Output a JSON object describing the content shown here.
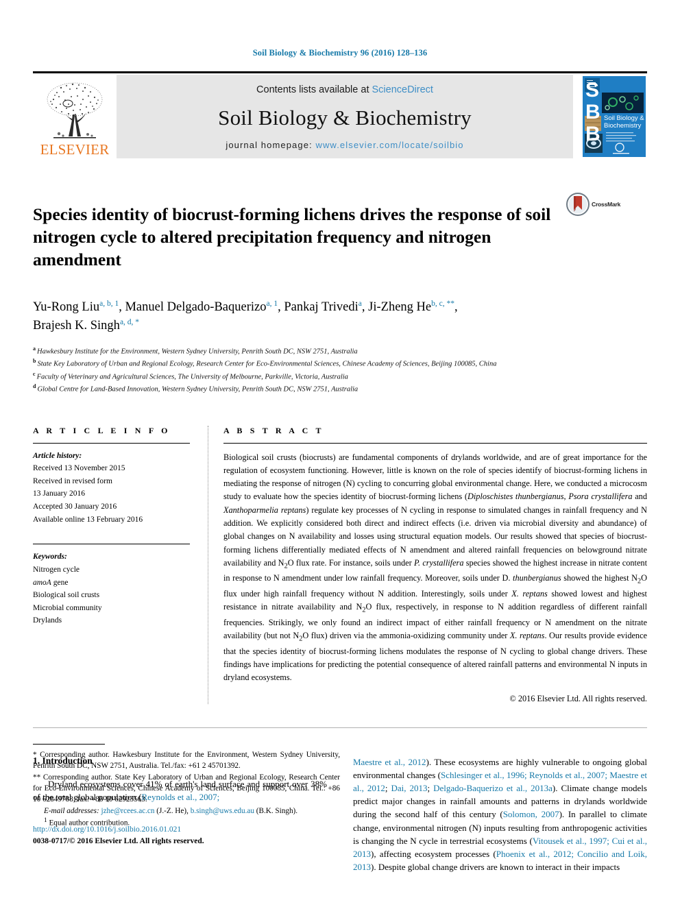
{
  "running_head": "Soil Biology & Biochemistry 96 (2016) 128–136",
  "masthead": {
    "contents_prefix": "Contents lists available at ",
    "sciencedirect": "ScienceDirect",
    "journal_title": "Soil Biology & Biochemistry",
    "homepage_prefix": "journal homepage: ",
    "homepage_url": "www.elsevier.com/locate/soilbio",
    "publisher_logo_text": "ELSEVIER",
    "cover_title_line1": "Soil Biology &",
    "cover_title_line2": "Biochemistry",
    "cover_letters": [
      "S",
      "B",
      "B"
    ]
  },
  "article": {
    "title": "Species identity of biocrust-forming lichens drives the response of soil nitrogen cycle to altered precipitation frequency and nitrogen amendment",
    "crossmark_label": "CrossMark",
    "authors_line1_a": "Yu-Rong Liu",
    "authors_line1_a_sup": "a, b, 1",
    "authors_line1_b": ", Manuel Delgado-Baquerizo",
    "authors_line1_b_sup": "a, 1",
    "authors_line1_c": ", Pankaj Trivedi",
    "authors_line1_c_sup": "a",
    "authors_line1_d": ", Ji-Zheng He",
    "authors_line1_d_sup": "b, c, **",
    "authors_line1_tail": ",",
    "authors_line2": "Brajesh K. Singh",
    "authors_line2_sup": "a, d, *",
    "affiliations": [
      {
        "mark": "a",
        "text": "Hawkesbury Institute for the Environment, Western Sydney University, Penrith South DC, NSW 2751, Australia"
      },
      {
        "mark": "b",
        "text": "State Key Laboratory of Urban and Regional Ecology, Research Center for Eco-Environmental Sciences, Chinese Academy of Sciences, Beijing 100085, China"
      },
      {
        "mark": "c",
        "text": "Faculty of Veterinary and Agricultural Sciences, The University of Melbourne, Parkville, Victoria, Australia"
      },
      {
        "mark": "d",
        "text": "Global Centre for Land-Based Innovation, Western Sydney University, Penrith South DC, NSW 2751, Australia"
      }
    ]
  },
  "article_info": {
    "heading": "A R T I C L E   I N F O",
    "history_label": "Article history:",
    "history": [
      "Received 13 November 2015",
      "Received in revised form",
      "13 January 2016",
      "Accepted 30 January 2016",
      "Available online 13 February 2016"
    ],
    "keywords_label": "Keywords:",
    "keywords": [
      "Nitrogen cycle",
      "amoA gene",
      "Biological soil crusts",
      "Microbial community",
      "Drylands"
    ]
  },
  "abstract": {
    "heading": "A B S T R A C T",
    "text_part1": "Biological soil crusts (biocrusts) are fundamental components of drylands worldwide, and are of great importance for the regulation of ecosystem functioning. However, little is known on the role of species identify of biocrust-forming lichens in mediating the response of nitrogen (N) cycling to concurring global environmental change. Here, we conducted a microcosm study to evaluate how the species identity of biocrust-forming lichens (",
    "species1": "Diploschistes thunbergianus",
    "sep1": ", ",
    "species2": "Psora crystallifera",
    "sep2": " and ",
    "species3": "Xanthoparmelia reptans",
    "text_part2": ") regulate key processes of N cycling in response to simulated changes in rainfall frequency and N addition. We explicitly considered both direct and indirect effects (i.e. driven via microbial diversity and abundance) of global changes on N availability and losses using structural equation models. Our results showed that species of biocrust-forming lichens differentially mediated effects of N amendment and altered rainfall frequencies on belowground nitrate availability and N",
    "sub1": "2",
    "text_part3": "O flux rate. For instance, soils under ",
    "species4": "P. crystallifera",
    "text_part4": " species showed the highest increase in nitrate content in response to N amendment under low rainfall frequency. Moreover, soils under D. ",
    "species5": "thunbergianus",
    "text_part5": " showed the highest N",
    "sub2": "2",
    "text_part6": "O flux under high rainfall frequency without N addition. Interestingly, soils under ",
    "species6": "X. reptans",
    "text_part7": " showed lowest and highest resistance in nitrate availability and N",
    "sub3": "2",
    "text_part8": "O flux, respectively, in response to N addition regardless of different rainfall frequencies. Strikingly, we only found an indirect impact of either rainfall frequency or N amendment on the nitrate availability (but not N",
    "sub4": "2",
    "text_part9": "O flux) driven via the ammonia-oxidizing community under ",
    "species7": "X. reptans",
    "text_part10": ". Our results provide evidence that the species identity of biocrust-forming lichens modulates the response of N cycling to global change drivers. These findings have implications for predicting the potential consequence of altered rainfall patterns and environmental N inputs in dryland ecosystems.",
    "copyright": "© 2016 Elsevier Ltd. All rights reserved."
  },
  "introduction": {
    "heading": "1. Introduction",
    "left_para_a": "Dryland ecosystems cover 41% of earth's land surface and support over 38% of the total global population (",
    "left_ref_a": "Reynolds et al., 2007;",
    "right_ref_a": "Maestre et al., 2012",
    "right_text_a": "). These ecosystems are highly vulnerable to ongoing global environmental changes (",
    "right_ref_b": "Schlesinger et al., 1996; Reynolds et al., 2007; Maestre et al., 2012",
    "right_text_b": "; ",
    "right_ref_c": "Dai, 2013",
    "right_text_c": "; ",
    "right_ref_d": "Delgado-Baquerizo et al., 2013a",
    "right_text_d": "). Climate change models predict major changes in rainfall amounts and patterns in drylands worldwide during the second half of this century (",
    "right_ref_e": "Solomon, 2007",
    "right_text_e": "). In parallel to climate change, environmental nitrogen (N) inputs resulting from anthropogenic activities is changing the N cycle in terrestrial ecosystems (",
    "right_ref_f": "Vitousek et al., 1997; Cui et al., 2013",
    "right_text_f": "), affecting ecosystem processes (",
    "right_ref_g": "Phoenix et al., 2012; Concilio and Loik, 2013",
    "right_text_g": "). Despite global change drivers are known to interact in their impacts"
  },
  "footnotes": {
    "corr1_mark": "*",
    "corr1": " Corresponding author. Hawkesbury Institute for the Environment, Western Sydney University, Penrith South DC, NSW 2751, Australia. Tel./fax: +61 2 45701392.",
    "corr2_mark": "**",
    "corr2": " Corresponding author. State Key Laboratory of Urban and Regional Ecology, Research Center for Eco-Environmental Sciences, Chinese Academy of Sciences, Beijing 100085, China. Tel.: +86 10 62849788; fax: +86 10 62923563.",
    "email_label": "E-mail addresses:",
    "email1": "jzhe@rcees.ac.cn",
    "email1_who": " (J.-Z. He), ",
    "email2": "b.singh@uws.edu.au",
    "email2_who": " (B.K. Singh).",
    "eq_mark": "1",
    "equal_contribution": " Equal author contribution."
  },
  "footer": {
    "doi": "http://dx.doi.org/10.1016/j.soilbio.2016.01.021",
    "issn_line": "0038-0717/© 2016 Elsevier Ltd. All rights reserved."
  },
  "colors": {
    "link": "#1679a8",
    "sciencedirect": "#3e8ec6",
    "elsevier_orange": "#e87722",
    "masthead_bg": "#e6e6e6",
    "cover_blue": "#1f7ec4",
    "crossmark_red": "#c0392b"
  }
}
